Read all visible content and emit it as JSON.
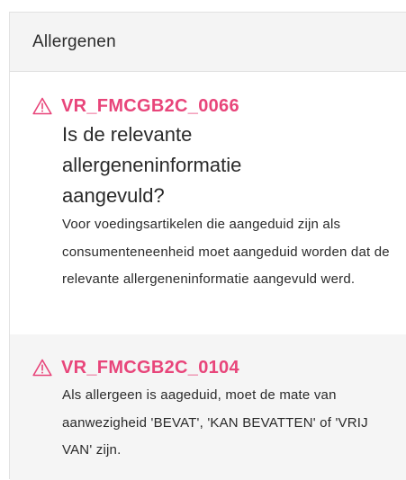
{
  "panel": {
    "title": "Allergenen"
  },
  "rules": [
    {
      "icon": "warning-triangle-icon",
      "id": "VR_FMCGB2C_0066",
      "question": "Is de relevante allergeneninformatie aangevuld?",
      "description": "Voor voedingsartikelen die aangeduid zijn als consumenteneenheid moet aangeduid worden dat de relevante allergeneninformatie aangevuld werd."
    },
    {
      "icon": "warning-triangle-icon",
      "id": "VR_FMCGB2C_0104",
      "description": "Als allergeen is aageduid, moet de mate van aanwezigheid 'BEVAT', 'KAN BEVATTEN' of 'VRIJ VAN' zijn."
    }
  ],
  "colors": {
    "accent": "#e8457a",
    "header_bg": "#f4f4f4",
    "alt_row_bg": "#f5f5f5"
  }
}
